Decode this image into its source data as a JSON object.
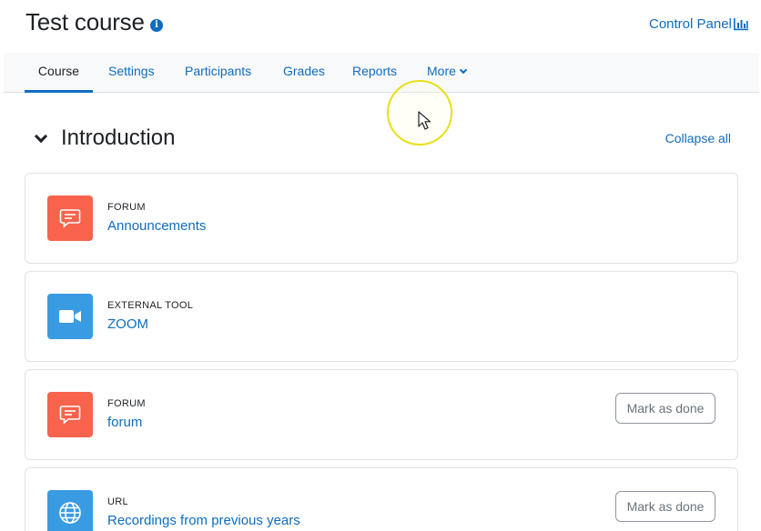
{
  "header": {
    "course_title": "Test course",
    "control_panel": "Control Panel"
  },
  "nav": {
    "tabs": [
      {
        "label": "Course",
        "active": true
      },
      {
        "label": "Settings"
      },
      {
        "label": "Participants"
      },
      {
        "label": "Grades"
      },
      {
        "label": "Reports"
      },
      {
        "label": "More"
      }
    ]
  },
  "section": {
    "title": "Introduction",
    "collapse_all": "Collapse all"
  },
  "activities": [
    {
      "type": "FORUM",
      "name": "Announcements",
      "icon": "forum-icon",
      "color": "#f7634d"
    },
    {
      "type": "EXTERNAL TOOL",
      "name": "ZOOM",
      "icon": "video-camera-icon",
      "color": "#399be2"
    },
    {
      "type": "FORUM",
      "name": "forum",
      "icon": "forum-icon",
      "color": "#f7634d",
      "mark_done": "Mark as done"
    },
    {
      "type": "URL",
      "name": "Recordings from previous years",
      "icon": "globe-icon",
      "color": "#399be2",
      "mark_done": "Mark as done"
    }
  ],
  "colors": {
    "link": "#0f6cbf",
    "forum": "#f7634d",
    "tool": "#399be2"
  }
}
